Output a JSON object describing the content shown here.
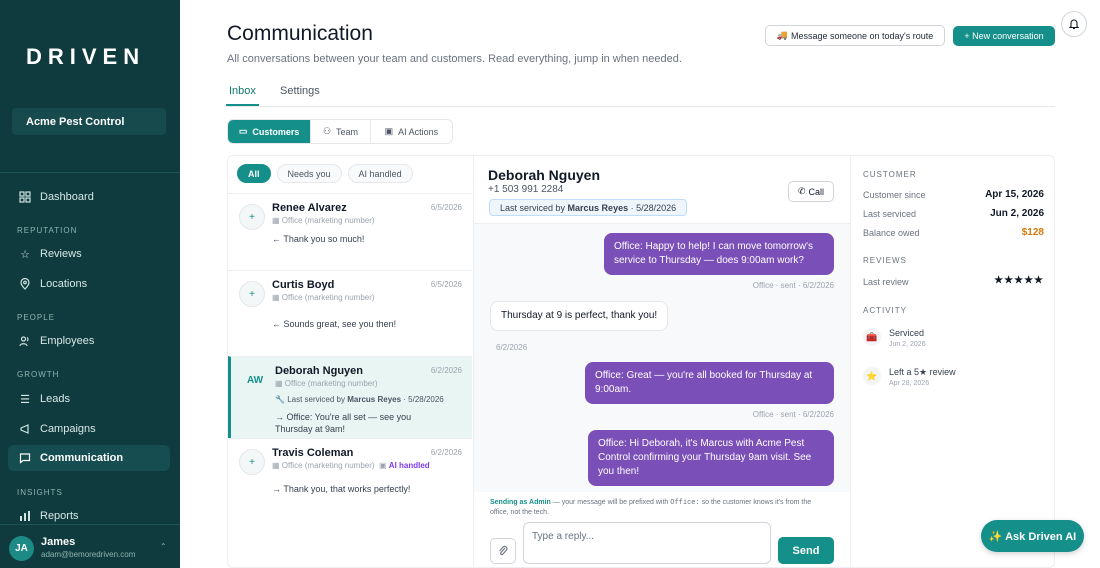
{
  "brand": {
    "logo": "DRIVEN",
    "org": "Acme Pest Control"
  },
  "sidebar": {
    "dashboard": "Dashboard",
    "sections": {
      "reputation": "REPUTATION",
      "people": "PEOPLE",
      "growth": "GROWTH",
      "insights": "INSIGHTS"
    },
    "items": {
      "reviews": "Reviews",
      "locations": "Locations",
      "employees": "Employees",
      "leads": "Leads",
      "campaigns": "Campaigns",
      "communication": "Communication",
      "reports": "Reports"
    },
    "user": {
      "initials": "JA",
      "name": "James",
      "email": "adam@bemoredriven.com"
    }
  },
  "header": {
    "title": "Communication",
    "subtitle": "All conversations between your team and customers. Read everything, jump in when needed.",
    "route_button": "Message someone on today's route",
    "new_button": "+ New conversation"
  },
  "tabs": {
    "inbox": "Inbox",
    "settings": "Settings"
  },
  "segments": {
    "customers": "Customers",
    "team": "Team",
    "ai_actions": "AI Actions"
  },
  "filters": {
    "all": "All",
    "needs_you": "Needs you",
    "ai_handled": "AI handled"
  },
  "conversations": [
    {
      "initials": "+",
      "name": "Renee Alvarez",
      "date": "6/5/2026",
      "meta": "Office (marketing number)",
      "preview": "← Thank you so much!"
    },
    {
      "initials": "+",
      "name": "Curtis Boyd",
      "date": "6/5/2026",
      "meta": "Office (marketing number)",
      "preview": "← Sounds great, see you then!"
    },
    {
      "initials": "AW",
      "name": "Deborah Nguyen",
      "date": "6/2/2026",
      "meta": "Office (marketing number)",
      "serviced_prefix": "Last serviced by",
      "serviced_by": "Marcus Reyes",
      "serviced_date": "· 5/28/2026",
      "preview1": "→ Office: You're all set — see you",
      "preview2": "Thursday at 9am!"
    },
    {
      "initials": "+",
      "name": "Travis Coleman",
      "date": "6/2/2026",
      "meta": "Office (marketing number)",
      "tag": "AI handled",
      "preview": "→ Thank you, that works perfectly!"
    }
  ],
  "chat": {
    "name": "Deborah Nguyen",
    "phone": "+1 503 991 2284",
    "serviced_prefix": "Last serviced by",
    "serviced_by": "Marcus Reyes",
    "serviced_date": "· 5/28/2026",
    "call": "Call",
    "messages": {
      "m1": "Office: Happy to help! I can move tomorrow's service to Thursday — does 9:00am work?",
      "m1_stamp": "Office · sent · 6/2/2026",
      "m2": "Thursday at 9 is perfect, thank you!",
      "m2_stamp": "6/2/2026",
      "m3": "Office: Great — you're all booked for Thursday at 9:00am.",
      "m3_stamp": "Office · sent · 6/2/2026",
      "m4": "Office: Hi Deborah, it's Marcus with Acme Pest Control confirming your Thursday 9am visit. See you then!"
    },
    "sending_label": "Sending as Admin",
    "sending_mid": "— your message will be prefixed with",
    "sending_code": "Office:",
    "sending_end": "so the customer knows it's from the office, not the tech.",
    "reply_placeholder": "Type a reply...",
    "send": "Send"
  },
  "info": {
    "customer_h": "CUSTOMER",
    "since_k": "Customer since",
    "since_v": "Apr 15, 2026",
    "last_k": "Last serviced",
    "last_v": "Jun 2, 2026",
    "bal_k": "Balance owed",
    "bal_v": "$128",
    "reviews_h": "REVIEWS",
    "review_k": "Last review",
    "review_v": "★★★★★",
    "activity_h": "ACTIVITY",
    "act1_t": "Serviced",
    "act1_d": "Jun 2, 2026",
    "act2_t": "Left a 5★ review",
    "act2_d": "Apr 28, 2026"
  },
  "ask_ai": "✨ Ask Driven AI",
  "colors": {
    "sidebar": "#0f3b3e",
    "accent": "#158f8a",
    "bubble": "#7b4fb8",
    "balance": "#d97706"
  }
}
